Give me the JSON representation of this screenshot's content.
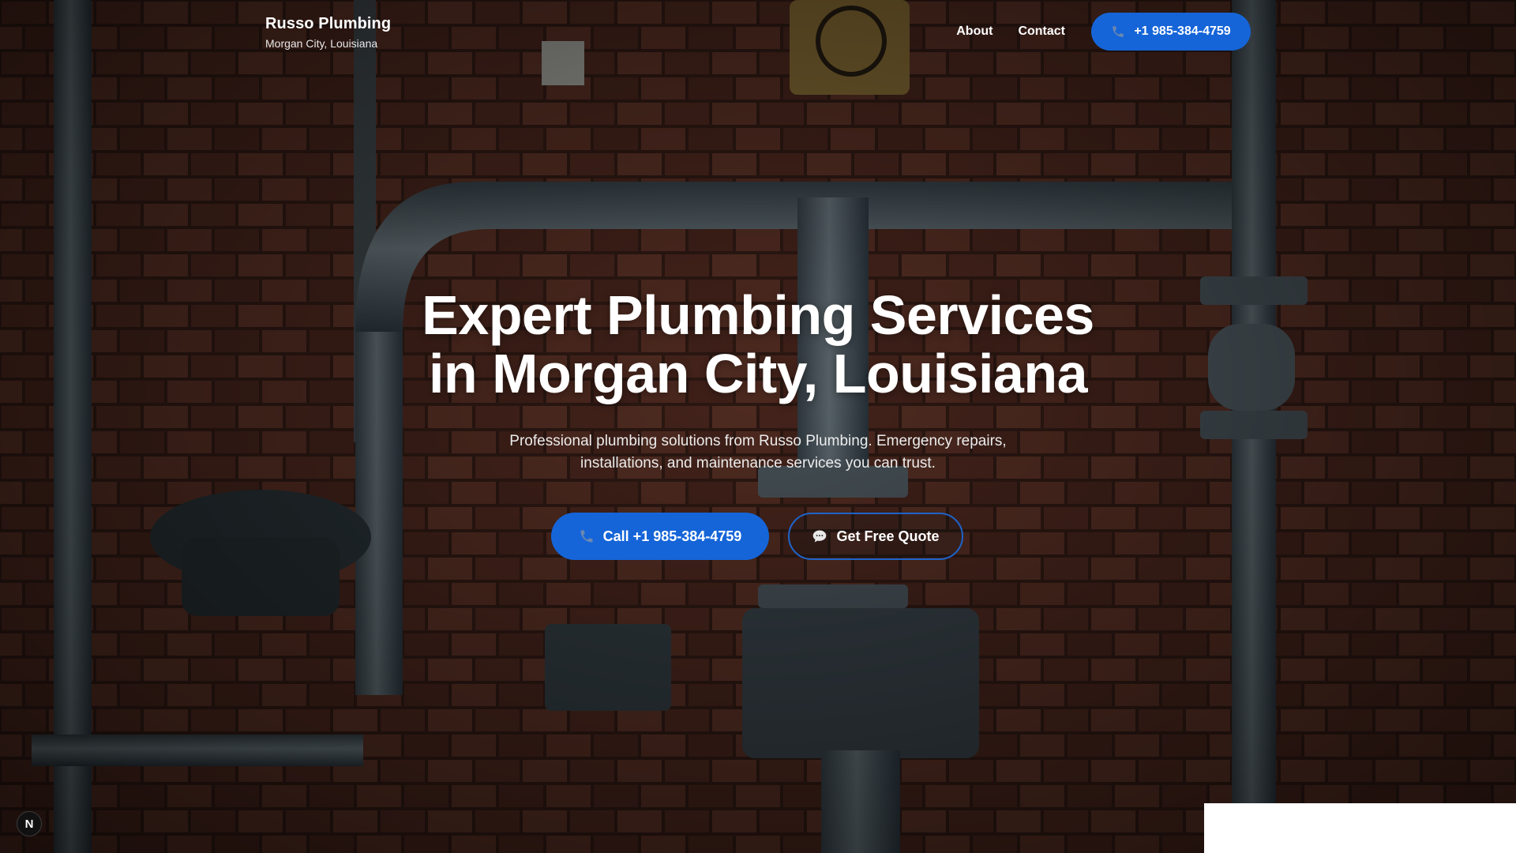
{
  "header": {
    "brand_name": "Russo Plumbing",
    "brand_location": "Morgan City, Louisiana",
    "nav": [
      {
        "label": "About"
      },
      {
        "label": "Contact"
      }
    ],
    "phone_button": {
      "label": "+1 985-384-4759",
      "icon": "phone-icon"
    }
  },
  "hero": {
    "title_line1": "Expert Plumbing Services",
    "title_line2": "in Morgan City, Louisiana",
    "subtitle_line1": "Professional plumbing solutions from Russo Plumbing. Emergency repairs,",
    "subtitle_line2": "installations, and maintenance services you can trust.",
    "primary_cta": {
      "label": "Call +1 985-384-4759",
      "icon": "phone-icon"
    },
    "secondary_cta": {
      "label": "Get Free Quote",
      "icon": "chat-bubble-icon"
    }
  },
  "corner_badge": {
    "label": "N"
  },
  "colors": {
    "accent": "#1565d8",
    "outline": "#1f63c9",
    "text": "#ffffff",
    "brick": "#5a2f23"
  }
}
